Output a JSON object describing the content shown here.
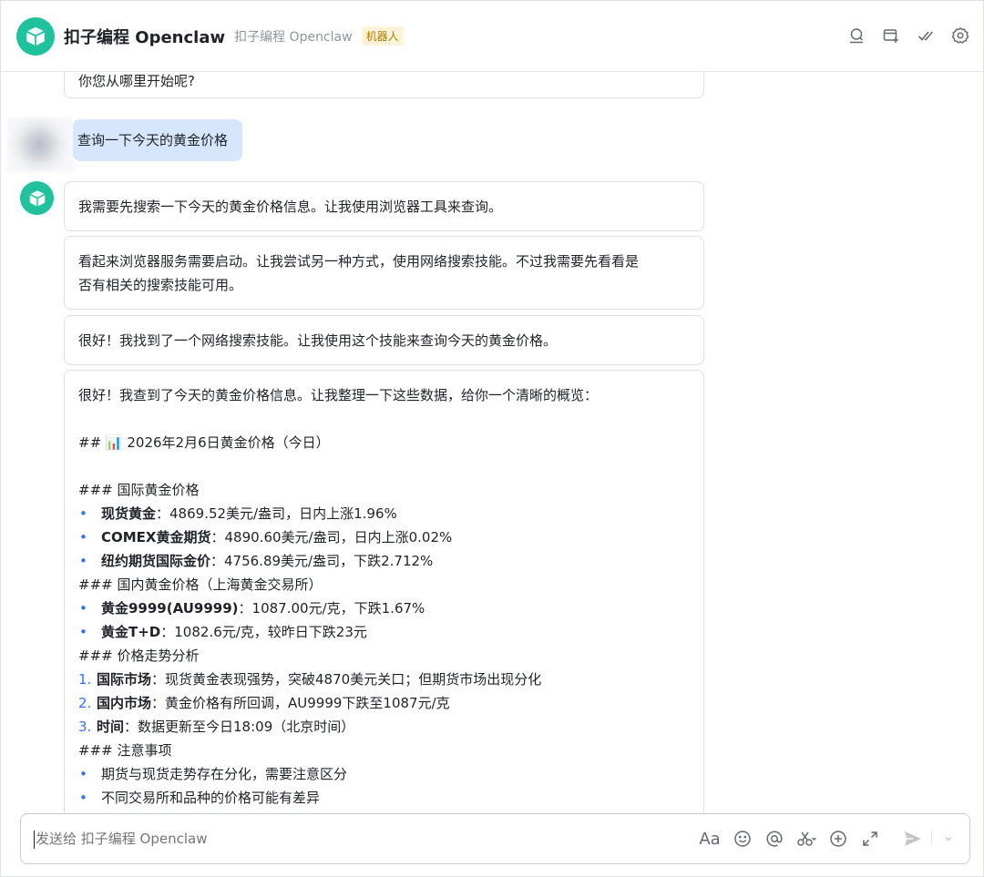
{
  "header": {
    "title": "扣子编程 Openclaw",
    "subtitle": "扣子编程 Openclaw",
    "badge": "机器人"
  },
  "chat": {
    "clipped_message": "你您从哪里开始呢?",
    "user_message": "查询一下今天的黄金价格",
    "bot_messages": [
      "我需要先搜索一下今天的黄金价格信息。让我使用浏览器工具来查询。",
      "看起来浏览器服务需要启动。让我尝试另一种方式，使用网络搜索技能。不过我需要先看看是",
      "否有相关的搜索技能可用。",
      "很好！我找到了一个网络搜索技能。让我使用这个技能来查询今天的黄金价格。"
    ],
    "report": {
      "intro": "很好！我查到了今天的黄金价格信息。让我整理一下这些数据，给你一个清晰的概览：",
      "h2_prefix": "## ",
      "h2_icon": "📊",
      "h2_text": " 2026年2月6日黄金价格（今日）",
      "s1_title": "### 国际黄金价格",
      "s1_items": [
        {
          "bold": "现货黄金",
          "rest": "：4869.52美元/盎司，日内上涨1.96%"
        },
        {
          "bold": "COMEX黄金期货",
          "rest": "：4890.60美元/盎司，日内上涨0.02%"
        },
        {
          "bold": "纽约期货国际金价",
          "rest": "：4756.89美元/盎司，下跌2.712%"
        }
      ],
      "s2_title": "### 国内黄金价格（上海黄金交易所）",
      "s2_items": [
        {
          "bold": "黄金9999(AU9999)",
          "rest": "：1087.00元/克，下跌1.67%"
        },
        {
          "bold": "黄金T+D",
          "rest": "：1082.6元/克，较昨日下跌23元"
        }
      ],
      "s3_title": "### 价格走势分析",
      "s3_items": [
        {
          "num": "1.",
          "bold": "国际市场",
          "rest": "：现货黄金表现强势，突破4870美元关口；但期货市场出现分化"
        },
        {
          "num": "2.",
          "bold": "国内市场",
          "rest": "：黄金价格有所回调，AU9999下跌至1087元/克"
        },
        {
          "num": "3.",
          "bold": "时间",
          "rest": "：数据更新至今日18:09（北京时间）"
        }
      ],
      "s4_title": "### 注意事项",
      "s4_items": [
        "期货与现货走势存在分化，需要注意区分",
        "不同交易所和品种的价格可能有差异"
      ],
      "bullet": "•"
    }
  },
  "input": {
    "placeholder": "发送给 扣子编程 Openclaw",
    "format_label": "Aa"
  },
  "colors": {
    "brand": "#1fc29c",
    "user_bubble": "#d5e6fd",
    "accent": "#3370ff"
  }
}
